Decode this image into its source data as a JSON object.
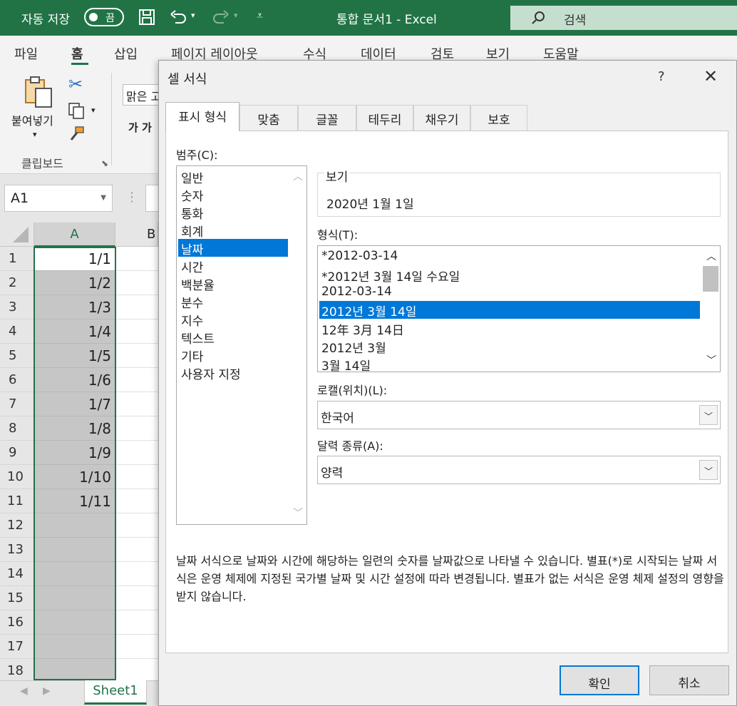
{
  "window": {
    "autosave_label": "자동 저장",
    "autosave_state": "끔",
    "doc_title": "통합 문서1  -  Excel",
    "search_label": "검색"
  },
  "ribbon": {
    "tabs": [
      "파일",
      "홈",
      "삽입",
      "페이지 레이아웃",
      "수식",
      "데이터",
      "검토",
      "보기",
      "도움말"
    ],
    "active_tab": "홈",
    "paste_label": "붙여넣기",
    "clipboard_group": "클립보드",
    "font_name": "맑은 고",
    "bold_glyph": "가  가"
  },
  "namebox": {
    "value": "A1"
  },
  "sheet": {
    "col_headers": [
      "A",
      "B"
    ],
    "rows": [
      {
        "n": "1",
        "a": "1/1"
      },
      {
        "n": "2",
        "a": "1/2"
      },
      {
        "n": "3",
        "a": "1/3"
      },
      {
        "n": "4",
        "a": "1/4"
      },
      {
        "n": "5",
        "a": "1/5"
      },
      {
        "n": "6",
        "a": "1/6"
      },
      {
        "n": "7",
        "a": "1/7"
      },
      {
        "n": "8",
        "a": "1/8"
      },
      {
        "n": "9",
        "a": "1/9"
      },
      {
        "n": "10",
        "a": "1/10"
      },
      {
        "n": "11",
        "a": "1/11"
      },
      {
        "n": "12",
        "a": ""
      },
      {
        "n": "13",
        "a": ""
      },
      {
        "n": "14",
        "a": ""
      },
      {
        "n": "15",
        "a": ""
      },
      {
        "n": "16",
        "a": ""
      },
      {
        "n": "17",
        "a": ""
      },
      {
        "n": "18",
        "a": ""
      }
    ],
    "sheet_tab": "Sheet1"
  },
  "dialog": {
    "title": "셀 서식",
    "help": "?",
    "tabs": [
      "표시 형식",
      "맞춤",
      "글꼴",
      "테두리",
      "채우기",
      "보호"
    ],
    "active_tab": "표시 형식",
    "category_label": "범주(C):",
    "categories": [
      "일반",
      "숫자",
      "통화",
      "회계",
      "날짜",
      "시간",
      "백분율",
      "분수",
      "지수",
      "텍스트",
      "기타",
      "사용자 지정"
    ],
    "selected_category": "날짜",
    "preview_label": "보기",
    "preview_value": "2020년 1월 1일",
    "type_label": "형식(T):",
    "types": [
      "*2012-03-14",
      "*2012년 3월 14일 수요일",
      "2012-03-14",
      "2012년 3월 14일",
      "12年 3月 14日",
      "2012년 3월",
      "3월 14일"
    ],
    "selected_type": "2012년 3월 14일",
    "locale_label": "로캘(위치)(L):",
    "locale_value": "한국어",
    "calendar_label": "달력 종류(A):",
    "calendar_value": "양력",
    "description": "날짜 서식으로 날짜와 시간에 해당하는 일련의 숫자를 날짜값으로 나타낼 수 있습니다. 별표(*)로 시작되는 날짜 서식은 운영 체제에 지정된 국가별 날짜 및 시간 설정에 따라 변경됩니다. 별표가 없는 서식은 운영 체제 설정의 영향을 받지 않습니다.",
    "ok_label": "확인",
    "cancel_label": "취소"
  },
  "colors": {
    "excel_green": "#217346",
    "selection_blue": "#0078d7"
  }
}
